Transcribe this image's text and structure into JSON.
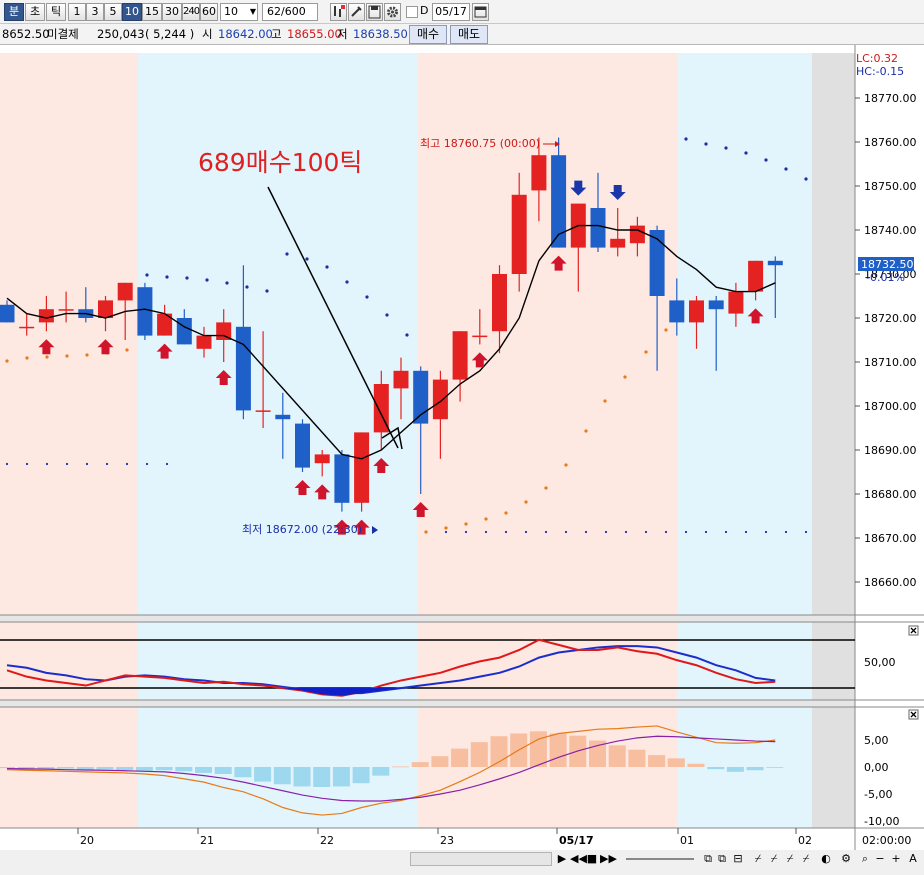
{
  "toolbar": {
    "period_tabs": [
      "분",
      "초",
      "틱"
    ],
    "intervals": [
      "1",
      "3",
      "5",
      "10",
      "15",
      "30",
      "240",
      "60"
    ],
    "active_interval": "10",
    "interval_select": "10",
    "count_value": "62",
    "count_total": "/600",
    "d_label": "D",
    "date_value": "05/17"
  },
  "infobar": {
    "price": "8652.50",
    "open_interest_label": "미결제",
    "open_interest": "250,043",
    "oi_change": "( 5,244 )",
    "open_label": "시",
    "open": "18642.00",
    "high_label": "고",
    "high": "18655.00",
    "low_label": "저",
    "low": "18638.50",
    "buy_button": "매수",
    "sell_button": "매도"
  },
  "chart_data": [
    {
      "type": "candlestick",
      "annotation": "689매수100틱",
      "high_marker": "최고 18760.75 (00:00)",
      "low_marker": "최저 18672.00 (22:30)",
      "lc_label": "LC:0.32",
      "hc_label": "HC:-0.15",
      "last_price": "18732.50",
      "last_change": "-0.01%",
      "y_ticks": [
        "18770.00",
        "18760.00",
        "18750.00",
        "18740.00",
        "18730.00",
        "18720.00",
        "18710.00",
        "18700.00",
        "18690.00",
        "18680.00",
        "18670.00",
        "18660.00"
      ],
      "x_labels": [
        "20",
        "21",
        "22",
        "23",
        "05/17",
        "01",
        "02",
        "02:00:00"
      ],
      "colors": {
        "up": "#e52222",
        "down": "#1f5fc8",
        "session_a": "#fde8e2",
        "session_b": "#e3f5fc",
        "buy_arrow": "#d0142c",
        "sell_arrow": "#1a36a8",
        "dots": "#1a2ea8",
        "dots_alt": "#e87a18"
      },
      "candles": [
        {
          "o": 18723,
          "h": 18724,
          "l": 18719,
          "c": 18719
        },
        {
          "o": 18718,
          "h": 18721,
          "l": 18716,
          "c": 18718
        },
        {
          "o": 18719,
          "h": 18725,
          "l": 18717,
          "c": 18722
        },
        {
          "o": 18722,
          "h": 18726,
          "l": 18719,
          "c": 18722
        },
        {
          "o": 18722,
          "h": 18727,
          "l": 18719,
          "c": 18720
        },
        {
          "o": 18720,
          "h": 18725,
          "l": 18717,
          "c": 18724
        },
        {
          "o": 18724,
          "h": 18728,
          "l": 18715,
          "c": 18728
        },
        {
          "o": 18727,
          "h": 18728,
          "l": 18715,
          "c": 18716
        },
        {
          "o": 18716,
          "h": 18723,
          "l": 18716,
          "c": 18721
        },
        {
          "o": 18720,
          "h": 18722,
          "l": 18714,
          "c": 18714
        },
        {
          "o": 18713,
          "h": 18718,
          "l": 18711,
          "c": 18716
        },
        {
          "o": 18715,
          "h": 18722,
          "l": 18710,
          "c": 18719
        },
        {
          "o": 18718,
          "h": 18732,
          "l": 18697,
          "c": 18699
        },
        {
          "o": 18699,
          "h": 18717,
          "l": 18695,
          "c": 18699
        },
        {
          "o": 18698,
          "h": 18703,
          "l": 18688,
          "c": 18697
        },
        {
          "o": 18696,
          "h": 18697,
          "l": 18685,
          "c": 18686
        },
        {
          "o": 18687,
          "h": 18690,
          "l": 18684,
          "c": 18689
        },
        {
          "o": 18689,
          "h": 18690,
          "l": 18676,
          "c": 18678
        },
        {
          "o": 18678,
          "h": 18694,
          "l": 18676,
          "c": 18694
        },
        {
          "o": 18694,
          "h": 18708,
          "l": 18690,
          "c": 18705
        },
        {
          "o": 18704,
          "h": 18711,
          "l": 18697,
          "c": 18708
        },
        {
          "o": 18708,
          "h": 18709,
          "l": 18680,
          "c": 18696
        },
        {
          "o": 18697,
          "h": 18708,
          "l": 18688,
          "c": 18706
        },
        {
          "o": 18706,
          "h": 18717,
          "l": 18701,
          "c": 18717
        },
        {
          "o": 18716,
          "h": 18722,
          "l": 18714,
          "c": 18716
        },
        {
          "o": 18717,
          "h": 18732,
          "l": 18712,
          "c": 18730
        },
        {
          "o": 18730,
          "h": 18753,
          "l": 18726,
          "c": 18748
        },
        {
          "o": 18749,
          "h": 18761,
          "l": 18742,
          "c": 18757
        },
        {
          "o": 18757,
          "h": 18761,
          "l": 18736,
          "c": 18736
        },
        {
          "o": 18736,
          "h": 18746,
          "l": 18726,
          "c": 18746
        },
        {
          "o": 18745,
          "h": 18753,
          "l": 18735,
          "c": 18736
        },
        {
          "o": 18736,
          "h": 18745,
          "l": 18734,
          "c": 18738
        },
        {
          "o": 18737,
          "h": 18743,
          "l": 18734,
          "c": 18741
        },
        {
          "o": 18740,
          "h": 18741,
          "l": 18708,
          "c": 18725
        },
        {
          "o": 18724,
          "h": 18729,
          "l": 18716,
          "c": 18719
        },
        {
          "o": 18719,
          "h": 18725,
          "l": 18713,
          "c": 18724
        },
        {
          "o": 18724,
          "h": 18725,
          "l": 18708,
          "c": 18722
        },
        {
          "o": 18721,
          "h": 18728,
          "l": 18718,
          "c": 18726
        },
        {
          "o": 18726,
          "h": 18733,
          "l": 18724,
          "c": 18733
        },
        {
          "o": 18733,
          "h": 18734,
          "l": 18720,
          "c": 18732
        }
      ],
      "ma": [
        18724.5,
        18721,
        18720,
        18721,
        18721,
        18720,
        18721.5,
        18722,
        18721,
        18718,
        18716,
        18716,
        18714,
        18709,
        18704,
        18699,
        18694,
        18689,
        18688,
        18690,
        18694,
        18698,
        18701,
        18705,
        18708,
        18713,
        18720,
        18733,
        18739,
        18741,
        18741,
        18740,
        18740,
        18738,
        18734,
        18731,
        18727,
        18726,
        18726,
        18728
      ],
      "buy_arrows": [
        2,
        5,
        8,
        11,
        15,
        16,
        17,
        18,
        19,
        21,
        24,
        28,
        38
      ],
      "sell_arrows": [
        29,
        31
      ]
    },
    {
      "type": "line",
      "y_ticks": [
        "50,00"
      ],
      "series": [
        {
          "color": "#1a2ecc",
          "values": [
            64,
            62,
            58,
            56,
            53,
            52,
            55,
            56,
            55,
            53,
            52,
            50,
            50,
            49,
            47,
            45,
            43,
            42,
            42,
            44,
            46,
            48,
            50,
            52,
            55,
            58,
            63,
            70,
            74,
            76,
            78,
            79,
            79,
            78,
            74,
            70,
            64,
            60,
            54,
            52
          ]
        },
        {
          "color": "#e01818",
          "values": [
            60,
            55,
            52,
            50,
            48,
            52,
            56,
            55,
            54,
            52,
            50,
            51,
            49,
            48,
            46,
            44,
            41,
            40,
            43,
            48,
            52,
            55,
            58,
            63,
            67,
            70,
            76,
            84,
            80,
            76,
            76,
            78,
            75,
            73,
            68,
            64,
            58,
            53,
            50,
            51
          ]
        }
      ]
    },
    {
      "type": "bar",
      "y_ticks": [
        "5,00",
        "0,00",
        "-5,00",
        "-10,00"
      ],
      "histogram": [
        -0.2,
        -0.3,
        -0.4,
        -0.3,
        -0.5,
        -0.4,
        -0.6,
        -0.7,
        -0.6,
        -0.8,
        -1.1,
        -1.3,
        -1.9,
        -2.7,
        -3.2,
        -3.6,
        -3.7,
        -3.6,
        -3.0,
        -1.6,
        0.1,
        0.9,
        2.0,
        3.4,
        4.6,
        5.7,
        6.2,
        6.6,
        6.2,
        5.8,
        4.9,
        4.0,
        3.2,
        2.2,
        1.6,
        0.6,
        -0.4,
        -0.9,
        -0.6,
        -0.1
      ],
      "lines": [
        {
          "color": "#e87a18",
          "values": [
            -0.5,
            -0.6,
            -0.7,
            -0.8,
            -0.9,
            -1.0,
            -1.1,
            -1.3,
            -1.6,
            -2.2,
            -2.8,
            -3.8,
            -4.6,
            -5.9,
            -7.5,
            -8.5,
            -8.9,
            -8.6,
            -7.5,
            -6.7,
            -6.2,
            -5.3,
            -4.3,
            -2.7,
            -1.0,
            1.0,
            3.2,
            5.2,
            6.2,
            6.6,
            7.0,
            7.1,
            7.4,
            7.6,
            6.5,
            5.5,
            4.5,
            4.4,
            4.5,
            5.0
          ]
        },
        {
          "color": "#8822a8",
          "values": [
            -0.3,
            -0.35,
            -0.4,
            -0.5,
            -0.55,
            -0.6,
            -0.7,
            -0.8,
            -0.9,
            -1.2,
            -1.6,
            -2.1,
            -2.8,
            -3.6,
            -4.4,
            -5.2,
            -5.8,
            -6.2,
            -6.3,
            -6.3,
            -6.0,
            -5.6,
            -5.0,
            -4.3,
            -3.3,
            -2.2,
            -1.0,
            0.4,
            1.8,
            3.0,
            4.0,
            4.8,
            5.4,
            5.7,
            5.6,
            5.4,
            5.2,
            5.0,
            4.8,
            4.7
          ]
        }
      ]
    }
  ]
}
